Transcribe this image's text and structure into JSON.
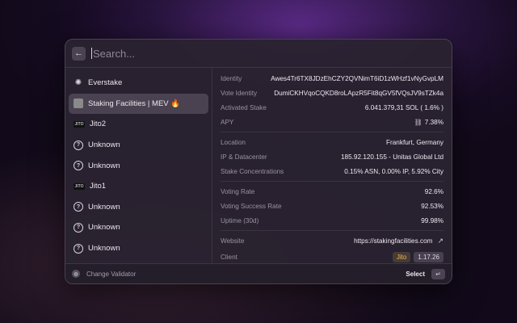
{
  "search": {
    "placeholder": "Search..."
  },
  "validators": [
    {
      "name": "Everstake",
      "icon": "everstake-logo-icon"
    },
    {
      "name": "Staking Facilities | MEV 🔥",
      "icon": "staking-facilities-logo-icon",
      "selected": true
    },
    {
      "name": "Jito2",
      "icon": "jito-logo-icon",
      "logo_text": "JITO"
    },
    {
      "name": "Unknown",
      "icon": "question-icon"
    },
    {
      "name": "Unknown",
      "icon": "question-icon"
    },
    {
      "name": "Jito1",
      "icon": "jito-logo-icon",
      "logo_text": "JITO"
    },
    {
      "name": "Unknown",
      "icon": "question-icon"
    },
    {
      "name": "Unknown",
      "icon": "question-icon"
    },
    {
      "name": "Unknown",
      "icon": "question-icon"
    }
  ],
  "details": {
    "identity_label": "Identity",
    "identity_value": "Awes4Tr6TX8JDzEhCZY2QVNimT6iD1zWHzf1vNyGvpLM",
    "vote_identity_label": "Vote Identity",
    "vote_identity_value": "DumiCKHVqoCQKD8roLApzR5Fit8qGV5fVQsJV9sTZk4a",
    "activated_stake_label": "Activated Stake",
    "activated_stake_value": "6.041.379,31 SOL ( 1.6% )",
    "apy_label": "APY",
    "apy_value": "7.38%",
    "location_label": "Location",
    "location_value": "Frankfurt, Germany",
    "ip_label": "IP & Datacenter",
    "ip_value": "185.92.120.155 - Unitas Global Ltd",
    "stake_conc_label": "Stake Concentrations",
    "stake_conc_value": "0.15% ASN,  0.00% IP,  5.92% City",
    "voting_rate_label": "Voting Rate",
    "voting_rate_value": "92.6%",
    "voting_success_label": "Voting Success Rate",
    "voting_success_value": "92.53%",
    "uptime_label": "Uptime (30d)",
    "uptime_value": "99.98%",
    "website_label": "Website",
    "website_value": "https://stakingfacilities.com",
    "client_label": "Client",
    "client_name": "Jito",
    "client_version": "1.17.26"
  },
  "footer": {
    "change_label": "Change Validator",
    "select_label": "Select",
    "enter_glyph": "↵"
  },
  "colors": {
    "accent": "#f5b54a",
    "panel": "#2a2230",
    "selected_row": "#4a4250"
  }
}
